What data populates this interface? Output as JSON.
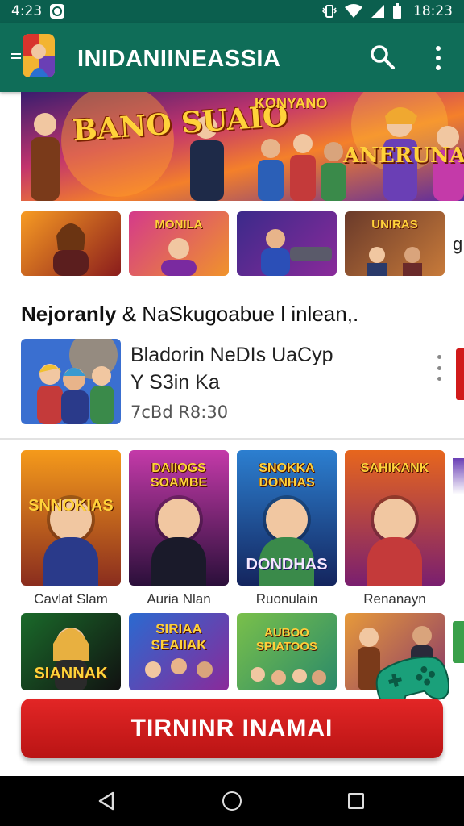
{
  "status_bar": {
    "time_left": "4:23",
    "time_right": "18:23",
    "icons": [
      "notification-icon",
      "vibrate-icon",
      "wifi-icon",
      "signal-icon",
      "battery-icon"
    ]
  },
  "app_bar": {
    "title": "INIDANIINEASSIA",
    "icons": [
      "menu-icon",
      "app-logo",
      "search-icon",
      "more-vert-icon"
    ],
    "color": "#0f6d58"
  },
  "banner": {
    "logo_left": "BANO SUAIO",
    "logo_top": "KONYANO",
    "logo_right": "ANERUNA"
  },
  "thumb_row": [
    {
      "title": ""
    },
    {
      "title": "MONILA"
    },
    {
      "title": ""
    },
    {
      "title": "UNIRAS"
    }
  ],
  "peek_letter": "g",
  "section": {
    "title_bold": "Nejoranly",
    "title_rest": "& NaSkugoabue l inlean,."
  },
  "featured": {
    "line1": "Bladorin NeDIs UaCyp",
    "line2": "Y S3in Ka",
    "line3": "7cBd R8:30"
  },
  "grid": [
    {
      "top": "",
      "bottom": "SNNOKIAS",
      "caption": "Cavlat Slam",
      "colors": [
        "#f59a1b",
        "#8a2d1e"
      ]
    },
    {
      "top": "DAIIOGS SOAMBE",
      "bottom": "",
      "caption": "Auria Nlan",
      "colors": [
        "#c43aa9",
        "#2b0f3a"
      ]
    },
    {
      "top": "SNOKKA DONHAS",
      "bottom": "DONDHAS",
      "caption": "Ruonulain",
      "colors": [
        "#2c7fd0",
        "#14255e"
      ]
    },
    {
      "top": "SAHIKANK",
      "bottom": "",
      "caption": "Renanayn",
      "colors": [
        "#e7661d",
        "#7a1f6f"
      ]
    }
  ],
  "grid_row2": [
    {
      "title": "SIANNAK"
    },
    {
      "title": "SIRIAA SEAIIAK"
    },
    {
      "title": "AUBOO SPIATOOS"
    },
    {
      "title": ""
    }
  ],
  "cta": {
    "label": "TIRNINR INAMAI",
    "color": "#d11a1a"
  },
  "nav": {
    "icons": [
      "back-icon",
      "home-icon",
      "recents-icon"
    ]
  }
}
